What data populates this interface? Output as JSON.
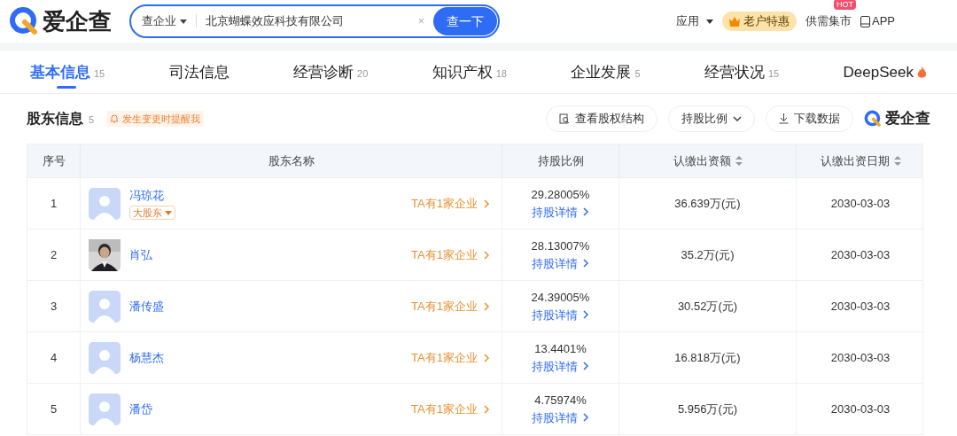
{
  "header": {
    "logo": "爱企查",
    "search": {
      "scope": "查企业",
      "value": "北京蝴蝶效应科技有限公司",
      "clear": "×",
      "button": "查一下"
    },
    "nav": [
      {
        "kind": "menu",
        "label": "应用"
      },
      {
        "kind": "promo",
        "label": "老户特惠"
      },
      {
        "kind": "hot",
        "label": "供需集市",
        "badge": "HOT"
      },
      {
        "kind": "app",
        "label": "APP"
      }
    ]
  },
  "tabs": [
    {
      "label": "基本信息",
      "count": "15",
      "selected": true
    },
    {
      "label": "司法信息",
      "selected": false
    },
    {
      "label": "经营诊断",
      "count": "20",
      "selected": false
    },
    {
      "label": "知识产权",
      "count": "18",
      "selected": false
    },
    {
      "label": "企业发展",
      "count": "5",
      "selected": false
    },
    {
      "label": "经营状况",
      "count": "15",
      "selected": false
    },
    {
      "label": "DeepSeek",
      "hot": true,
      "selected": false
    }
  ],
  "section": {
    "title": "股东信息",
    "count": "5",
    "alert": "发生变更时提醒我",
    "actions": [
      "查看股权结构",
      "持股比例",
      "下载数据"
    ],
    "logo": "爱企查"
  },
  "table": {
    "columns": [
      "序号",
      "股东名称",
      "持股比例",
      "认缴出资额",
      "认缴出资日期"
    ],
    "rows": [
      {
        "index": "1",
        "name": "冯琼花",
        "avatar": {
          "kind": "placeholder"
        },
        "badge": "大股东",
        "link": "TA有1家企业",
        "ratio": "29.28005%",
        "detail": "持股详情",
        "amount": "36.639万(元)",
        "date": "2030-03-03"
      },
      {
        "index": "2",
        "name": "肖弘",
        "link": "TA有1家企业",
        "ratio": "28.13007%",
        "detail": "持股详情",
        "amount": "35.2万(元)",
        "date": "2030-03-03"
      },
      {
        "index": "3",
        "name": "潘传盛",
        "avatar": {
          "kind": "placeholder"
        },
        "link": "TA有1家企业",
        "ratio": "24.39005%",
        "detail": "持股详情",
        "amount": "30.52万(元)",
        "date": "2030-03-03"
      },
      {
        "index": "4",
        "name": "杨慧杰",
        "avatar": {
          "kind": "placeholder"
        },
        "link": "TA有1家企业",
        "ratio": "13.4401%",
        "detail": "持股详情",
        "amount": "16.818万(元)",
        "date": "2030-03-03"
      },
      {
        "index": "5",
        "name": "潘岱",
        "avatar": {
          "kind": "placeholder"
        },
        "link": "TA有1家企业",
        "ratio": "4.75974%",
        "detail": "持股详情",
        "amount": "5.956万(元)",
        "date": "2030-03-03"
      }
    ]
  }
}
